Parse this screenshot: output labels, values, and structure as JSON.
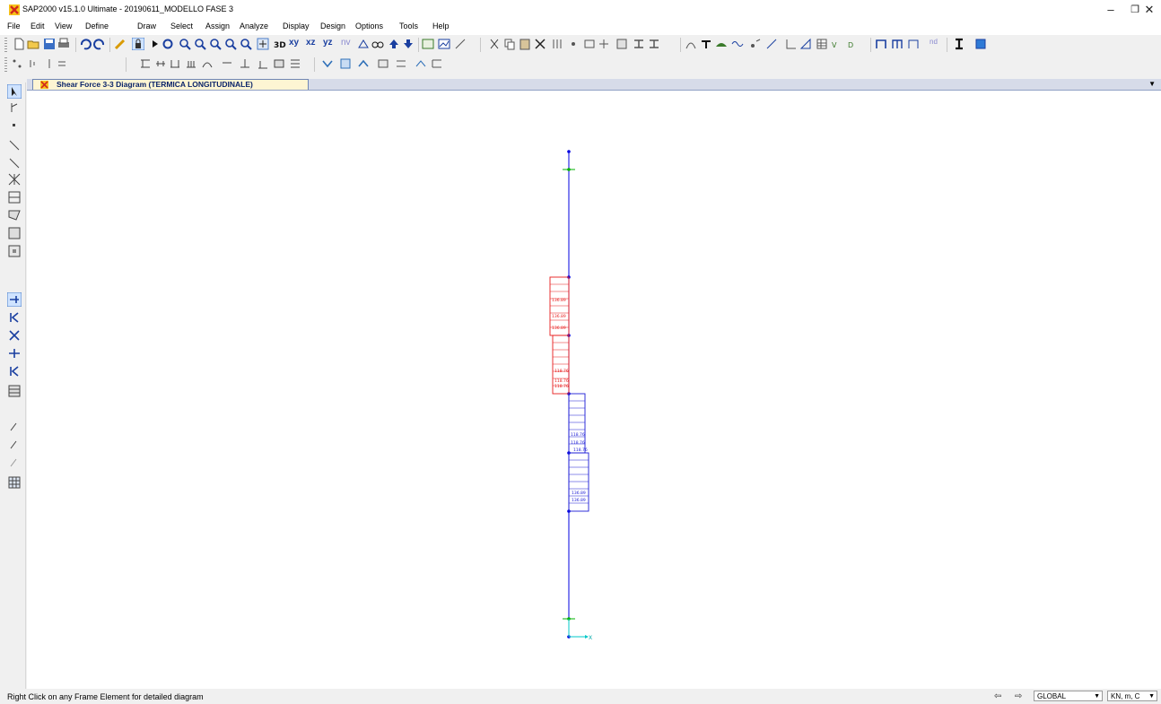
{
  "window": {
    "title": "SAP2000 v15.1.0 Ultimate  - 20190611_MODELLO FASE 3",
    "controls": [
      "–",
      "❐",
      "✕"
    ]
  },
  "menu": [
    "File",
    "Edit",
    "View",
    "Define",
    "Draw",
    "Select",
    "Assign",
    "Analyze",
    "Display",
    "Design",
    "Options",
    "Tools",
    "Help"
  ],
  "toolbar": {
    "view_labels": [
      "xy",
      "xz",
      "yz",
      "nv",
      "nd"
    ]
  },
  "tab": {
    "label": "Shear Force 3-3 Diagram  (TERMICA LONGITUDINALE)",
    "dropdown": "▼"
  },
  "diagram": {
    "segments": [
      {
        "sign": "negative",
        "values": [
          "136.89",
          "136.89",
          "136.89"
        ]
      },
      {
        "sign": "negative",
        "values": [
          "118.76",
          "118.76",
          "118.76"
        ]
      },
      {
        "sign": "positive",
        "values": [
          "118.76",
          "118.76",
          "118.76"
        ]
      },
      {
        "sign": "positive",
        "values": [
          "136.89",
          "136.89"
        ]
      }
    ],
    "axis_label": "X",
    "colors": {
      "negative": "#e81c1c",
      "positive": "#1c1cd6",
      "frame": "#0000e0",
      "support": "#00b000"
    }
  },
  "status": {
    "hint": "Right Click on any Frame Element for detailed diagram",
    "coord_system": "GLOBAL",
    "units": "KN, m, C",
    "nav_left": "⇦",
    "nav_right": "⇨"
  }
}
